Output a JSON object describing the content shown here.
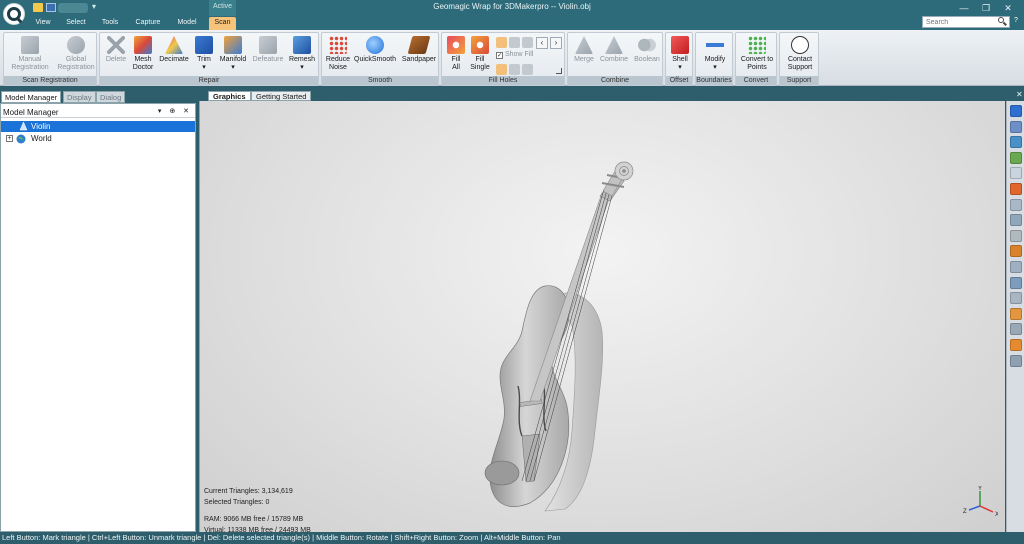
{
  "window": {
    "title": "Geomagic Wrap for 3DMakerpro -- Violin.obj",
    "context_tab": "Active",
    "minimize": "—",
    "maximize": "❐",
    "close": "✕"
  },
  "ribbon_tabs": [
    {
      "label": "View"
    },
    {
      "label": "Select"
    },
    {
      "label": "Tools"
    },
    {
      "label": "Capture"
    },
    {
      "label": "Model"
    },
    {
      "label": "Scan",
      "active": true
    }
  ],
  "search": {
    "placeholder": "Search"
  },
  "help": "?",
  "ribbon_groups": {
    "scan_registration": {
      "title": "Scan Registration",
      "buttons": [
        {
          "label": "Manual\nRegistration",
          "enabled": false
        },
        {
          "label": "Global\nRegistration",
          "enabled": false
        }
      ]
    },
    "repair": {
      "title": "Repair",
      "buttons": [
        {
          "label": "Delete",
          "enabled": false
        },
        {
          "label": "Mesh\nDoctor",
          "enabled": true
        },
        {
          "label": "Decimate",
          "enabled": true
        },
        {
          "label": "Trim\n▾",
          "enabled": true
        },
        {
          "label": "Manifold\n▾",
          "enabled": true
        },
        {
          "label": "Defeature",
          "enabled": false
        },
        {
          "label": "Remesh\n▾",
          "enabled": true
        }
      ]
    },
    "smooth": {
      "title": "Smooth",
      "buttons": [
        {
          "label": "Reduce\nNoise",
          "enabled": true
        },
        {
          "label": "QuickSmooth",
          "enabled": true
        },
        {
          "label": "Sandpaper",
          "enabled": true
        }
      ]
    },
    "fill_holes": {
      "title": "Fill Holes",
      "buttons": [
        {
          "label": "Fill\nAll",
          "enabled": true
        },
        {
          "label": "Fill\nSingle",
          "enabled": true
        }
      ],
      "show_fill": "Show Fill",
      "show_fill_checked": true,
      "prev_arrow": "‹",
      "next_arrow": "›"
    },
    "combine": {
      "title": "Combine",
      "buttons": [
        {
          "label": "Merge",
          "enabled": false
        },
        {
          "label": "Combine",
          "enabled": false
        },
        {
          "label": "Boolean",
          "enabled": false
        }
      ]
    },
    "offset": {
      "title": "Offset",
      "buttons": [
        {
          "label": "Shell\n▾",
          "enabled": true
        }
      ]
    },
    "boundaries": {
      "title": "Boundaries",
      "buttons": [
        {
          "label": "Modify\n▾",
          "enabled": true
        }
      ]
    },
    "convert": {
      "title": "Convert",
      "buttons": [
        {
          "label": "Convert to\nPoints",
          "enabled": true
        }
      ]
    },
    "support": {
      "title": "Support",
      "buttons": [
        {
          "label": "Contact\nSupport",
          "enabled": true
        }
      ]
    }
  },
  "left_panel": {
    "tabs": [
      {
        "label": "Model Manager",
        "active": true
      },
      {
        "label": "Display",
        "active": false
      },
      {
        "label": "Dialog",
        "active": false
      }
    ],
    "header": "Model Manager",
    "header_controls": "▾ ⊕ ✕",
    "tree": [
      {
        "label": "Violin",
        "selected": true,
        "icon": "mesh-icon"
      },
      {
        "label": "World",
        "selected": false,
        "icon": "globe-icon",
        "expander": "+"
      }
    ]
  },
  "graphics": {
    "tabs": [
      {
        "label": "Graphics",
        "active": true
      },
      {
        "label": "Getting Started",
        "active": false
      }
    ],
    "close": "✕",
    "stats": {
      "current_triangles": "Current Triangles: 3,134,619",
      "selected_triangles": "Selected Triangles: 0",
      "ram": "RAM: 9066 MB free / 15789 MB",
      "virtual": "Virtual: 11338 MB free / 24493 MB"
    },
    "triad": {
      "x": "X",
      "y": "Y",
      "z": "Z"
    }
  },
  "right_toolbar": {
    "icons": [
      {
        "name": "view-front-icon",
        "color": "#2f6fd1"
      },
      {
        "name": "view-rotate-icon",
        "color": "#6f8fc9"
      },
      {
        "name": "view-iso-icon",
        "color": "#4a90c8"
      },
      {
        "name": "view-fit-icon",
        "color": "#6aa84f"
      },
      {
        "name": "zoom-icon",
        "color": "#c9d4de"
      },
      {
        "name": "color-map-icon",
        "color": "#e0662c"
      },
      {
        "name": "render-icon",
        "color": "#a9b8c6"
      },
      {
        "name": "camera-icon",
        "color": "#8fa6bb"
      },
      {
        "name": "pen-icon",
        "color": "#b0b8c0"
      },
      {
        "name": "brush-icon",
        "color": "#d9822b"
      },
      {
        "name": "section-icon",
        "color": "#9fb0c2"
      },
      {
        "name": "selection-icon",
        "color": "#7d9bbd"
      },
      {
        "name": "lasso-icon",
        "color": "#a8b6c4"
      },
      {
        "name": "paint-icon",
        "color": "#e3963e"
      },
      {
        "name": "layer-icon",
        "color": "#9aa8b6"
      },
      {
        "name": "fill-color-icon",
        "color": "#e58a2e"
      },
      {
        "name": "screenshot-icon",
        "color": "#8fa0b3"
      }
    ]
  },
  "status_bar": "Left Button: Mark triangle | Ctrl+Left Button: Unmark triangle | Del: Delete selected triangle(s) | Middle Button: Rotate | Shift+Right Button: Zoom | Alt+Middle Button: Pan",
  "colors": {
    "title_bar": "#2d6b7a",
    "active_tab": "#f7c27a",
    "selection": "#1a73d9",
    "viewport": "#dedede"
  }
}
